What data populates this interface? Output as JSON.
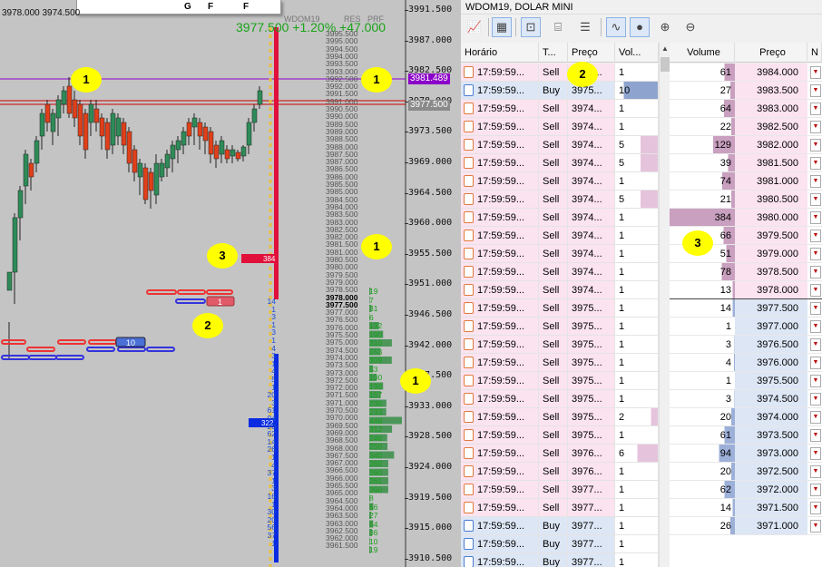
{
  "chart": {
    "corner_prices": "3978.000  3974.500",
    "symbol_tag": "WDOM19",
    "res_tag": "RES",
    "prf_tag": "PRF",
    "big_price": "3977.500 +1.20% +47.000",
    "toolbar_letters": [
      "G",
      "F",
      "F"
    ],
    "axis_labels": [
      "3991.500",
      "3987.000",
      "3982.500",
      "3978.000",
      "3973.500",
      "3969.000",
      "3964.500",
      "3960.000",
      "3955.500",
      "3951.000",
      "3946.500",
      "3942.000",
      "3937.500",
      "3933.000",
      "3928.500",
      "3924.000",
      "3919.500",
      "3915.000",
      "3910.500"
    ],
    "ladder_prices": [
      "3995.500",
      "3995.000",
      "3994.500",
      "3994.000",
      "3993.500",
      "3993.000",
      "3992.500",
      "3992.000",
      "3991.500",
      "3991.000",
      "3990.500",
      "3990.000",
      "3989.500",
      "3989.000",
      "3988.500",
      "3988.000",
      "3987.500",
      "3987.000",
      "3986.500",
      "3986.000",
      "3985.500",
      "3985.000",
      "3984.500",
      "3984.000",
      "3983.500",
      "3983.000",
      "3982.500",
      "3982.000",
      "3981.500",
      "3981.000",
      "3980.500",
      "3980.000",
      "3979.500",
      "3979.000",
      "3978.500",
      "3978.000",
      "3977.500",
      "3977.000",
      "3976.500",
      "3976.000",
      "3975.500",
      "3975.000",
      "3974.500",
      "3974.000",
      "3973.500",
      "3973.000",
      "3972.500",
      "3972.000",
      "3971.500",
      "3971.000",
      "3970.500",
      "3970.000",
      "3969.500",
      "3969.000",
      "3968.500",
      "3968.000",
      "3967.500",
      "3967.000",
      "3966.500",
      "3966.000",
      "3965.500",
      "3965.000",
      "3964.500",
      "3964.000",
      "3963.500",
      "3963.000",
      "3962.500",
      "3962.000",
      "3961.500"
    ],
    "price_tag_purple": "3981.489",
    "price_tag_gray": "3977.500",
    "volume_label_384": "384",
    "volume_label_1": "1",
    "volume_label_10": "10",
    "volume_label_322": "322",
    "left_ladder_numbers": [
      "14",
      "1",
      "3",
      "1",
      "3",
      "1",
      "4",
      "3",
      "1",
      "4",
      "5",
      "1",
      "20",
      "3",
      "61",
      "94",
      "20",
      "62",
      "14",
      "26",
      "1",
      "4",
      "37",
      "1",
      "3",
      "16",
      "1",
      "30",
      "20",
      "56",
      "37",
      "1"
    ],
    "green_volumes": [
      "19",
      "7",
      "31",
      "6",
      "132",
      "190",
      "310",
      "153",
      "309",
      "53",
      "100",
      "190",
      "157",
      "235",
      "233",
      "448",
      "312",
      "246",
      "250",
      "340",
      "260",
      "260",
      "261",
      "260",
      "8",
      "56",
      "27",
      "54",
      "36",
      "10",
      "19"
    ],
    "marks": [
      "1",
      "1",
      "1",
      "1",
      "2",
      "2",
      "3",
      "3"
    ],
    "colors": {
      "chart_bg": "#c4c4c4",
      "up_candle": "#2e8b57",
      "down_candle": "#e0401a",
      "purple_line": "#8b00c8",
      "red_line": "#cc0000",
      "ask_bar": "#e0103a",
      "bid_bar": "#0a2be0",
      "green_vol": "#2e8b40"
    }
  },
  "panel": {
    "title": "WDOM19, DOLAR MINI",
    "toolbar_icons": [
      "chart-icon",
      "table-icon",
      "screenshot-icon",
      "cylinder-icon",
      "list-icon",
      "pulse-icon",
      "bubbles-icon",
      "zoom-in-icon",
      "zoom-out-icon"
    ],
    "trades_headers": [
      "Horário",
      "T...",
      "Preço",
      "Vol..."
    ],
    "trades": [
      {
        "time": "17:59:59...",
        "type": "Sell",
        "price": "3974...",
        "vol": "1"
      },
      {
        "time": "17:59:59...",
        "type": "Buy",
        "price": "3975...",
        "vol": "10"
      },
      {
        "time": "17:59:59...",
        "type": "Sell",
        "price": "3974...",
        "vol": "1"
      },
      {
        "time": "17:59:59...",
        "type": "Sell",
        "price": "3974...",
        "vol": "1"
      },
      {
        "time": "17:59:59...",
        "type": "Sell",
        "price": "3974...",
        "vol": "5"
      },
      {
        "time": "17:59:59...",
        "type": "Sell",
        "price": "3974...",
        "vol": "5"
      },
      {
        "time": "17:59:59...",
        "type": "Sell",
        "price": "3974...",
        "vol": "1"
      },
      {
        "time": "17:59:59...",
        "type": "Sell",
        "price": "3974...",
        "vol": "5"
      },
      {
        "time": "17:59:59...",
        "type": "Sell",
        "price": "3974...",
        "vol": "1"
      },
      {
        "time": "17:59:59...",
        "type": "Sell",
        "price": "3974...",
        "vol": "1"
      },
      {
        "time": "17:59:59...",
        "type": "Sell",
        "price": "3974...",
        "vol": "1"
      },
      {
        "time": "17:59:59...",
        "type": "Sell",
        "price": "3974...",
        "vol": "1"
      },
      {
        "time": "17:59:59...",
        "type": "Sell",
        "price": "3974...",
        "vol": "1"
      },
      {
        "time": "17:59:59...",
        "type": "Sell",
        "price": "3975...",
        "vol": "1"
      },
      {
        "time": "17:59:59...",
        "type": "Sell",
        "price": "3975...",
        "vol": "1"
      },
      {
        "time": "17:59:59...",
        "type": "Sell",
        "price": "3975...",
        "vol": "1"
      },
      {
        "time": "17:59:59...",
        "type": "Sell",
        "price": "3975...",
        "vol": "1"
      },
      {
        "time": "17:59:59...",
        "type": "Sell",
        "price": "3975...",
        "vol": "1"
      },
      {
        "time": "17:59:59...",
        "type": "Sell",
        "price": "3975...",
        "vol": "1"
      },
      {
        "time": "17:59:59...",
        "type": "Sell",
        "price": "3975...",
        "vol": "2"
      },
      {
        "time": "17:59:59...",
        "type": "Sell",
        "price": "3975...",
        "vol": "1"
      },
      {
        "time": "17:59:59...",
        "type": "Sell",
        "price": "3976...",
        "vol": "6"
      },
      {
        "time": "17:59:59...",
        "type": "Sell",
        "price": "3976...",
        "vol": "1"
      },
      {
        "time": "17:59:59...",
        "type": "Sell",
        "price": "3977...",
        "vol": "1"
      },
      {
        "time": "17:59:59...",
        "type": "Sell",
        "price": "3977...",
        "vol": "1"
      },
      {
        "time": "17:59:59...",
        "type": "Buy",
        "price": "3977...",
        "vol": "1"
      },
      {
        "time": "17:59:59...",
        "type": "Buy",
        "price": "3977...",
        "vol": "1"
      },
      {
        "time": "17:59:59...",
        "type": "Buy",
        "price": "3977...",
        "vol": "1"
      }
    ],
    "depth_headers": [
      "Volume",
      "Preço",
      "N"
    ],
    "asks": [
      {
        "vol": "61",
        "price": "3984.000"
      },
      {
        "vol": "27",
        "price": "3983.500"
      },
      {
        "vol": "64",
        "price": "3983.000"
      },
      {
        "vol": "22",
        "price": "3982.500"
      },
      {
        "vol": "129",
        "price": "3982.000"
      },
      {
        "vol": "39",
        "price": "3981.500"
      },
      {
        "vol": "74",
        "price": "3981.000"
      },
      {
        "vol": "21",
        "price": "3980.500"
      },
      {
        "vol": "384",
        "price": "3980.000"
      },
      {
        "vol": "66",
        "price": "3979.500"
      },
      {
        "vol": "51",
        "price": "3979.000"
      },
      {
        "vol": "78",
        "price": "3978.500"
      },
      {
        "vol": "13",
        "price": "3978.000"
      }
    ],
    "bids": [
      {
        "vol": "14",
        "price": "3977.500"
      },
      {
        "vol": "1",
        "price": "3977.000"
      },
      {
        "vol": "3",
        "price": "3976.500"
      },
      {
        "vol": "4",
        "price": "3976.000"
      },
      {
        "vol": "1",
        "price": "3975.500"
      },
      {
        "vol": "3",
        "price": "3974.500"
      },
      {
        "vol": "20",
        "price": "3974.000"
      },
      {
        "vol": "61",
        "price": "3973.500"
      },
      {
        "vol": "94",
        "price": "3973.000"
      },
      {
        "vol": "20",
        "price": "3972.500"
      },
      {
        "vol": "62",
        "price": "3972.000"
      },
      {
        "vol": "14",
        "price": "3971.500"
      },
      {
        "vol": "26",
        "price": "3971.000"
      }
    ]
  }
}
